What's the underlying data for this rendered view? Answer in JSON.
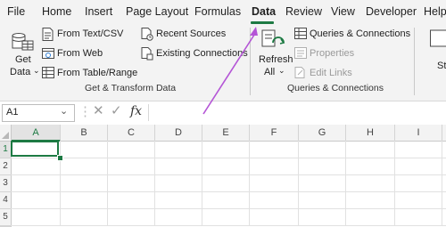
{
  "menu": {
    "tabs": [
      "File",
      "Home",
      "Insert",
      "Page Layout",
      "Formulas",
      "Data",
      "Review",
      "View",
      "Developer",
      "Help"
    ],
    "active": "Data"
  },
  "ribbon": {
    "get_data": {
      "line1": "Get",
      "line2": "Data"
    },
    "from_text_csv": "From Text/CSV",
    "from_web": "From Web",
    "from_table_range": "From Table/Range",
    "recent_sources": "Recent Sources",
    "existing_connections": "Existing Connections",
    "group1_label": "Get & Transform Data",
    "refresh_all": {
      "line1": "Refresh",
      "line2": "All"
    },
    "queries_connections": "Queries & Connections",
    "properties": "Properties",
    "edit_links": "Edit Links",
    "group2_label": "Queries & Connections",
    "partial_right": "St"
  },
  "formula_bar": {
    "name_box": "A1",
    "fx": "fx",
    "value": ""
  },
  "grid": {
    "columns": [
      "A",
      "B",
      "C",
      "D",
      "E",
      "F",
      "G",
      "H",
      "I"
    ],
    "rows": [
      "1",
      "2",
      "3",
      "4",
      "5",
      "6"
    ],
    "selected": "A1"
  },
  "colors": {
    "accent_green": "#1d7a43",
    "arrow": "#b455d6"
  }
}
